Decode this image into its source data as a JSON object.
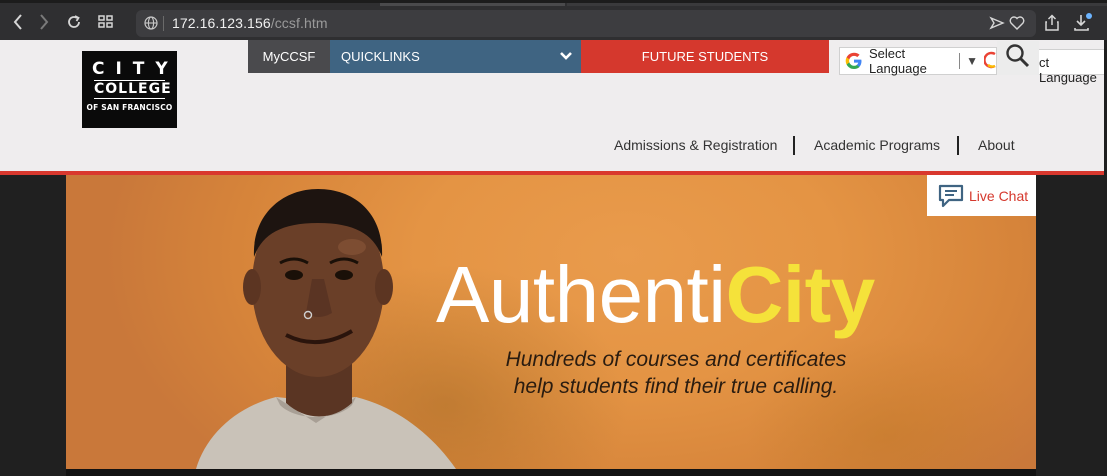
{
  "browser": {
    "url_host": "172.16.123.156",
    "url_path": "/ccsf.htm",
    "icons": [
      "back-icon",
      "forward-icon",
      "reload-icon",
      "tab-overview-icon",
      "globe-icon",
      "send-icon",
      "heart-icon",
      "share-icon",
      "download-icon"
    ]
  },
  "logo": {
    "line1": "CITY",
    "line2": "COLLEGE",
    "line3": "OF SAN FRANCISCO"
  },
  "topnav": {
    "mycssf": "MyCCSF",
    "quicklinks": "QUICKLINKS",
    "future_students": "FUTURE STUDENTS"
  },
  "translate": {
    "select_language": "Select Language",
    "overflow_text": "ct Language"
  },
  "mainnav": {
    "admissions": "Admissions & Registration",
    "academic": "Academic Programs",
    "about": "About"
  },
  "hero": {
    "headline_part1": "Authenti",
    "headline_part2": "City",
    "tagline_line1": "Hundreds of courses and certificates",
    "tagline_line2": "help students find their true calling."
  },
  "livechat": {
    "label": "Live Chat"
  },
  "colors": {
    "brand_red": "#d5382d",
    "quicklinks_blue": "#3f6482",
    "headline_yellow": "#f5e23a",
    "hero_orange": "#e49444"
  }
}
